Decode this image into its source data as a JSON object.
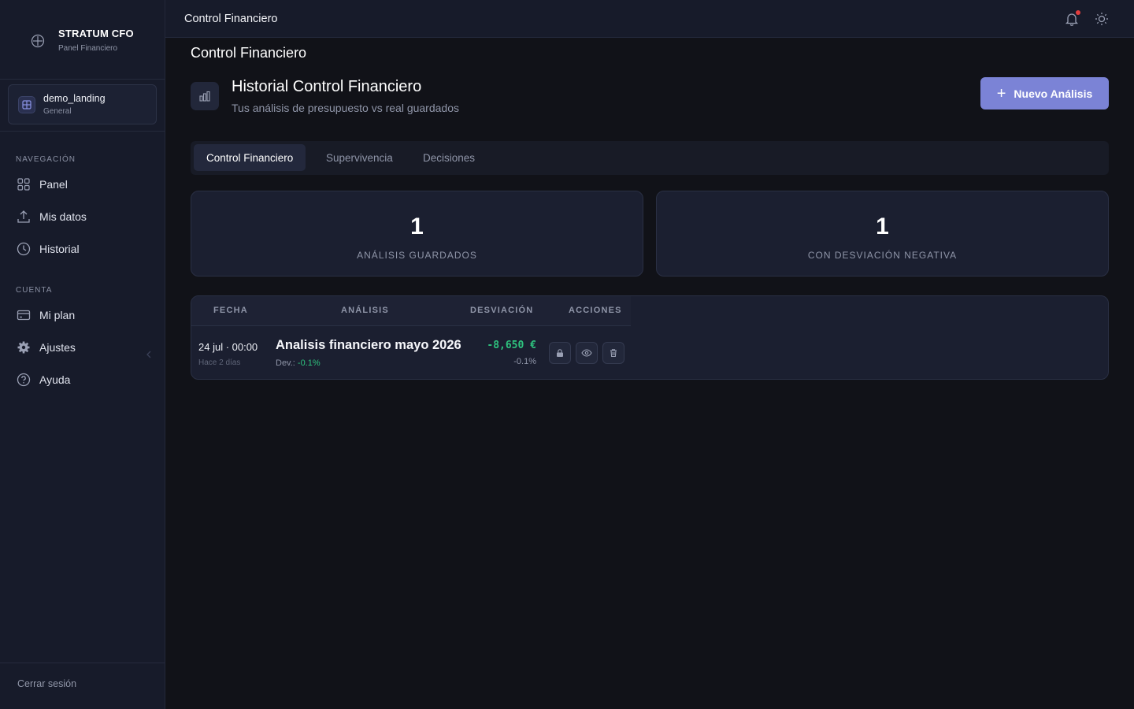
{
  "sidebar": {
    "brand_title": "STRATUM CFO",
    "brand_subtitle": "Panel Financiero",
    "workspace": {
      "name": "demo_landing",
      "sub": "General"
    },
    "nav_section": "NAVEGACIÓN",
    "nav_items": [
      {
        "label": "Panel",
        "icon": "grid-icon"
      },
      {
        "label": "Mis datos",
        "icon": "upload-icon"
      },
      {
        "label": "Historial",
        "icon": "clock-icon"
      }
    ],
    "account_section": "CUENTA",
    "account_items": [
      {
        "label": "Mi plan",
        "icon": "card-icon"
      },
      {
        "label": "Ajustes",
        "icon": "gear-icon"
      },
      {
        "label": "Ayuda",
        "icon": "help-icon"
      }
    ],
    "logout_label": "Cerrar sesión"
  },
  "topbar": {
    "title": "Control Financiero",
    "notification_dot_color": "#e23d3d"
  },
  "main": {
    "page_title": "Control Financiero",
    "header_title": "Historial Control Financiero",
    "header_subtitle": "Tus análisis de presupuesto vs real guardados",
    "new_button_label": "Nuevo Análisis",
    "tabs": [
      {
        "label": "Control Financiero",
        "active": true
      },
      {
        "label": "Supervivencia",
        "active": false
      },
      {
        "label": "Decisiones",
        "active": false
      }
    ],
    "stats": [
      {
        "value": "1",
        "label": "ANÁLISIS GUARDADOS"
      },
      {
        "value": "1",
        "label": "CON DESVIACIÓN NEGATIVA"
      }
    ],
    "table": {
      "headers": [
        "FECHA",
        "ANÁLISIS",
        "DESVIACIÓN",
        "ACCIONES"
      ],
      "rows": [
        {
          "date": "24 jul · 00:00",
          "ago": "Hace 2 días",
          "name": "Analisis financiero mayo 2026",
          "dev_label": "Dev.:",
          "dev_value": "-0.1%",
          "amount": "-8,650 €",
          "pct": "-0.1%"
        }
      ]
    }
  },
  "colors": {
    "accent": "#7b83d6",
    "positive": "#2ec27e"
  }
}
